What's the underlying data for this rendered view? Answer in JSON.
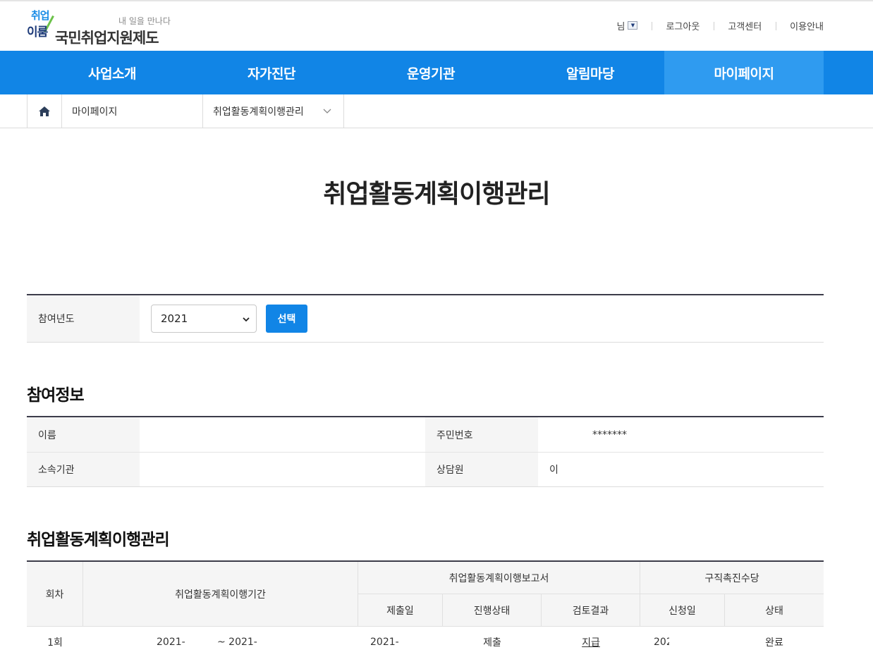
{
  "logo": {
    "mark_top": "취업",
    "mark_bottom": "이룸",
    "slogan": "내 일을 만나다",
    "name": "국민취업지원제도"
  },
  "util_nav": {
    "user_suffix": "님",
    "logout": "로그아웃",
    "customer_center": "고객센터",
    "guide": "이용안내"
  },
  "gnb": {
    "items": [
      {
        "label": "사업소개"
      },
      {
        "label": "자가진단"
      },
      {
        "label": "운영기관"
      },
      {
        "label": "알림마당"
      },
      {
        "label": "마이페이지",
        "active": true
      }
    ],
    "color": "#1185e6",
    "active_color": "#2f9bf0"
  },
  "breadcrumb": {
    "home_icon": "home-icon",
    "level1": "마이페이지",
    "level2": "취업활동계획이행관리"
  },
  "page_title": "취업활동계획이행관리",
  "year_filter": {
    "label": "참여년도",
    "selected": "2021",
    "button": "선택"
  },
  "participation": {
    "title": "참여정보",
    "name_label": "이름",
    "name_value": "",
    "rrn_label": "주민번호",
    "rrn_value": "*******",
    "org_label": "소속기관",
    "org_value": "",
    "counselor_label": "상담원",
    "counselor_value": "이"
  },
  "plan_table": {
    "title": "취업활동계획이행관리",
    "headers": {
      "round": "회차",
      "period": "취업활동계획이행기간",
      "report_group": "취업활동계획이행보고서",
      "submit_date": "제출일",
      "progress": "진행상태",
      "review": "검토결과",
      "allowance_group": "구직촉진수당",
      "apply_date": "신청일",
      "status": "상태"
    },
    "rows": [
      {
        "round": "1회",
        "period_start": "2021-",
        "period_sep": "~ 2021-",
        "submit_date": "2021-",
        "progress": "제출",
        "review": "지급",
        "apply_date": "202",
        "status": "완료"
      }
    ]
  }
}
